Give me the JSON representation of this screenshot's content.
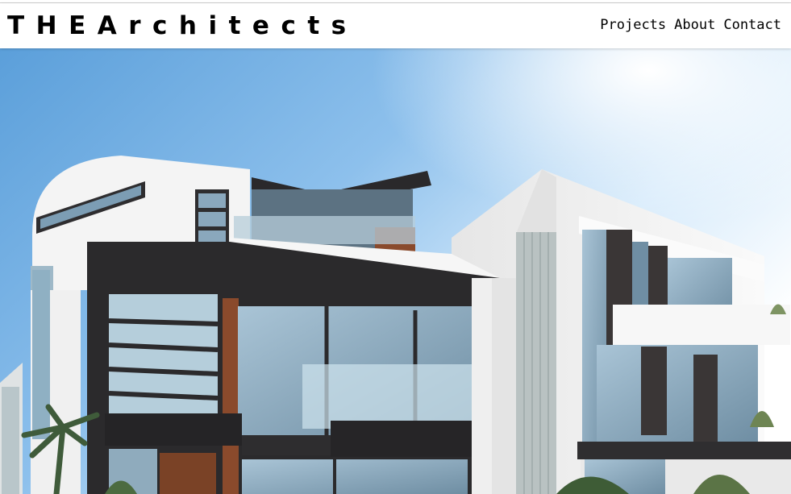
{
  "brand": {
    "title": "THEArchitects"
  },
  "nav": {
    "items": [
      {
        "label": "Projects"
      },
      {
        "label": "About"
      },
      {
        "label": "Contact"
      }
    ]
  },
  "hero": {
    "image_icon": "modern-house-photo"
  },
  "colors": {
    "header_bg": "#ffffff",
    "text": "#000000",
    "sky_top": "#5fa2dc",
    "sky_bright": "#eef6fd",
    "wall_white": "#f1f1f1",
    "frame_dark": "#2b2a2c",
    "glass": "#9bb7c9",
    "wood": "#8a4a2c"
  }
}
